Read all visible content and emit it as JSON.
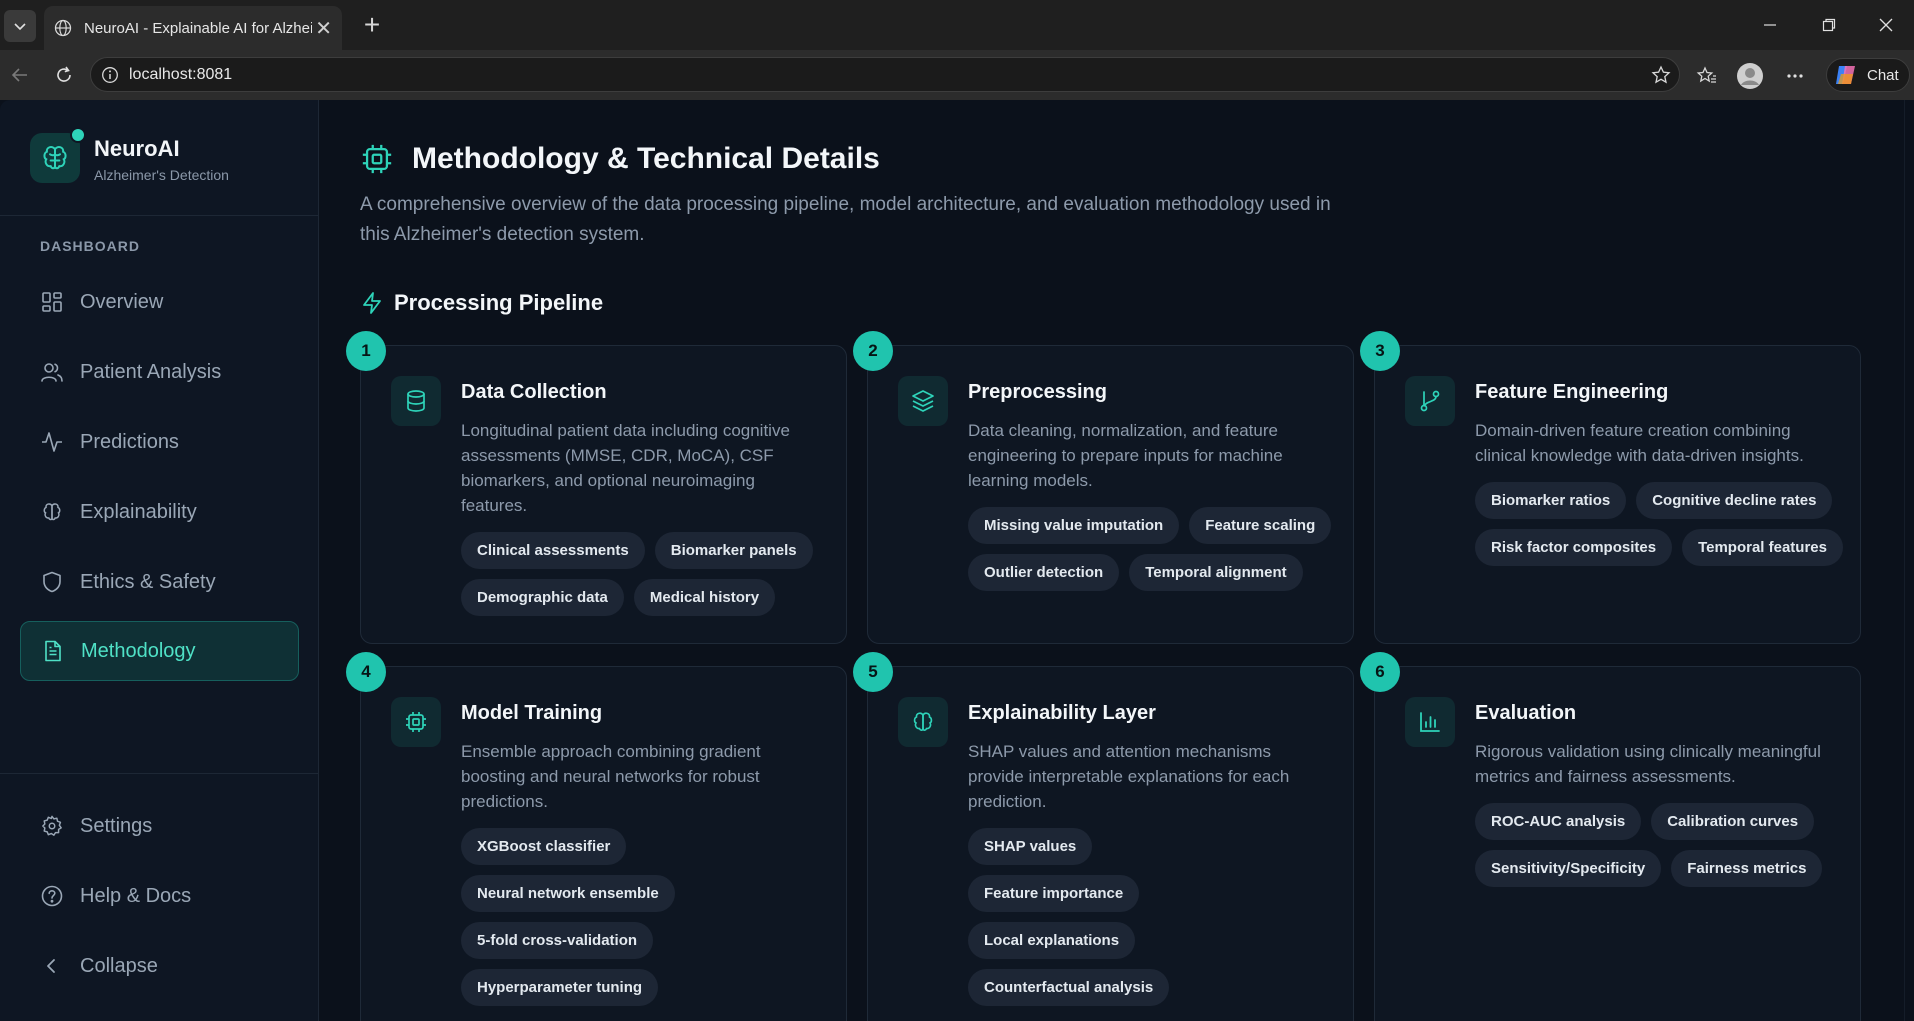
{
  "browser": {
    "tab_title": "NeuroAI - Explainable AI for Alzheimer's",
    "url": "localhost:8081",
    "chat_label": "Chat"
  },
  "sidebar": {
    "brand_name": "NeuroAI",
    "brand_subtitle": "Alzheimer's Detection",
    "section_label": "DASHBOARD",
    "items": [
      {
        "label": "Overview",
        "icon": "grid-icon"
      },
      {
        "label": "Patient Analysis",
        "icon": "users-icon"
      },
      {
        "label": "Predictions",
        "icon": "activity-icon"
      },
      {
        "label": "Explainability",
        "icon": "brain-icon"
      },
      {
        "label": "Ethics & Safety",
        "icon": "shield-icon"
      },
      {
        "label": "Methodology",
        "icon": "document-icon",
        "active": true
      }
    ],
    "footer": [
      {
        "label": "Settings",
        "icon": "gear-icon"
      },
      {
        "label": "Help & Docs",
        "icon": "help-icon"
      },
      {
        "label": "Collapse",
        "icon": "chevron-left-icon"
      }
    ]
  },
  "main": {
    "title": "Methodology & Technical Details",
    "description": "A comprehensive overview of the data processing pipeline, model architecture, and evaluation methodology used in this Alzheimer's detection system.",
    "section_title": "Processing Pipeline",
    "steps": [
      {
        "number": "1",
        "icon": "database-icon",
        "title": "Data Collection",
        "description": "Longitudinal patient data including cognitive assessments (MMSE, CDR, MoCA), CSF biomarkers, and optional neuroimaging features.",
        "tags": [
          "Clinical assessments",
          "Biomarker panels",
          "Demographic data",
          "Medical history"
        ]
      },
      {
        "number": "2",
        "icon": "layers-icon",
        "title": "Preprocessing",
        "description": "Data cleaning, normalization, and feature engineering to prepare inputs for machine learning models.",
        "tags": [
          "Missing value imputation",
          "Feature scaling",
          "Outlier detection",
          "Temporal alignment"
        ]
      },
      {
        "number": "3",
        "icon": "git-branch-icon",
        "title": "Feature Engineering",
        "description": "Domain-driven feature creation combining clinical knowledge with data-driven insights.",
        "tags": [
          "Biomarker ratios",
          "Cognitive decline rates",
          "Risk factor composites",
          "Temporal features"
        ]
      },
      {
        "number": "4",
        "icon": "cpu-icon",
        "title": "Model Training",
        "description": "Ensemble approach combining gradient boosting and neural networks for robust predictions.",
        "tags": [
          "XGBoost classifier",
          "Neural network ensemble",
          "5-fold cross-validation",
          "Hyperparameter tuning"
        ]
      },
      {
        "number": "5",
        "icon": "brain-icon",
        "title": "Explainability Layer",
        "description": "SHAP values and attention mechanisms provide interpretable explanations for each prediction.",
        "tags": [
          "SHAP values",
          "Feature importance",
          "Local explanations",
          "Counterfactual analysis"
        ]
      },
      {
        "number": "6",
        "icon": "bar-chart-icon",
        "title": "Evaluation",
        "description": "Rigorous validation using clinically meaningful metrics and fairness assessments.",
        "tags": [
          "ROC-AUC analysis",
          "Calibration curves",
          "Sensitivity/Specificity",
          "Fairness metrics"
        ]
      }
    ]
  },
  "colors": {
    "accent": "#2ed3b9",
    "background": "#0b111b",
    "sidebar": "#0e1623",
    "card": "#0e1622"
  }
}
